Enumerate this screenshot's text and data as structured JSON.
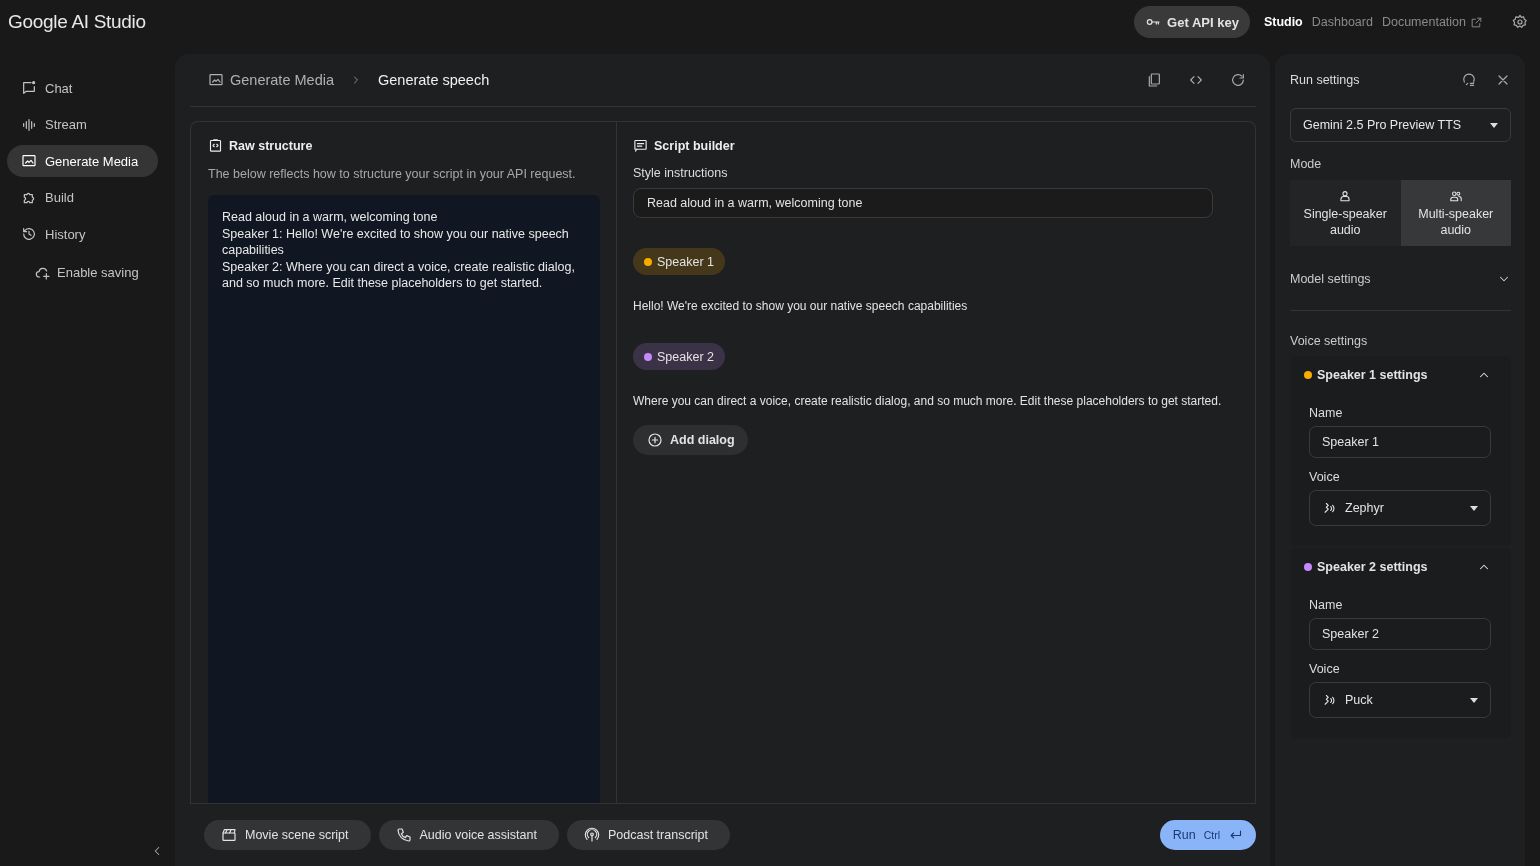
{
  "logo": "Google AI Studio",
  "header": {
    "api_key_button": "Get API key",
    "nav": [
      {
        "label": "Studio",
        "selected": true,
        "external": false
      },
      {
        "label": "Dashboard",
        "selected": false,
        "external": false
      },
      {
        "label": "Documentation",
        "selected": false,
        "external": true
      }
    ]
  },
  "sidebar": {
    "items": [
      {
        "label": "Chat",
        "selected": false
      },
      {
        "label": "Stream",
        "selected": false
      },
      {
        "label": "Generate Media",
        "selected": true
      },
      {
        "label": "Build",
        "selected": false
      },
      {
        "label": "History",
        "selected": false
      }
    ],
    "enable_saving": "Enable saving"
  },
  "breadcrumb": [
    "Generate Media",
    "Generate speech"
  ],
  "raw": {
    "title": "Raw structure",
    "description": "The below reflects how to structure your script in your API request.",
    "lines": [
      "Read aloud in a warm, welcoming tone",
      "Speaker 1: Hello! We're excited to show you our native speech capabilities",
      "Speaker 2: Where you can direct a voice, create realistic dialog, and so much more. Edit these placeholders to get started."
    ]
  },
  "script": {
    "title": "Script builder",
    "style_label": "Style instructions",
    "style_value": "Read aloud in a warm, welcoming tone",
    "dialogs": [
      {
        "speaker": "Speaker 1",
        "color": "#f9ab00",
        "text": "Hello! We're excited to show you our native speech capabilities"
      },
      {
        "speaker": "Speaker 2",
        "color": "#c58af9",
        "text": "Where you can direct a voice, create realistic dialog, and so much more. Edit these placeholders to get started."
      }
    ],
    "add_button": "Add dialog"
  },
  "presets": [
    {
      "label": "Movie scene script"
    },
    {
      "label": "Audio voice assistant"
    },
    {
      "label": "Podcast transcript"
    }
  ],
  "run": {
    "label": "Run",
    "shortcut": "Ctrl"
  },
  "run_settings": {
    "title": "Run settings",
    "model": "Gemini 2.5 Pro Preview TTS",
    "mode_label": "Mode",
    "modes": [
      {
        "label": "Single-speaker audio",
        "selected": false
      },
      {
        "label": "Multi-speaker audio",
        "selected": true
      }
    ],
    "model_settings": {
      "label": "Model settings",
      "expanded": false
    },
    "voice_settings": "Voice settings",
    "speakers": [
      {
        "title": "Speaker 1 settings",
        "color": "#f9ab00",
        "expanded": true,
        "name_label": "Name",
        "name": "Speaker 1",
        "voice_label": "Voice",
        "voice": "Zephyr"
      },
      {
        "title": "Speaker 2 settings",
        "color": "#c58af9",
        "expanded": true,
        "name_label": "Name",
        "name": "Speaker 2",
        "voice_label": "Voice",
        "voice": "Puck"
      }
    ]
  }
}
